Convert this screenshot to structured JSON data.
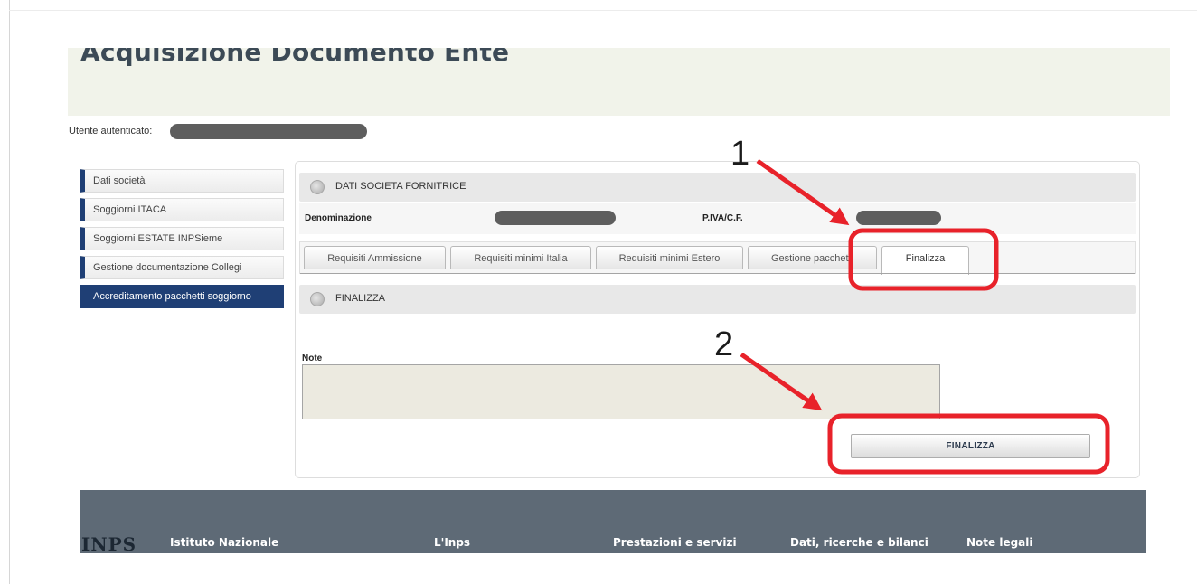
{
  "page_title": "Acquisizione Documento Ente",
  "user_label": "Utente autenticato:",
  "sidebar": {
    "items": [
      {
        "label": "Dati società",
        "active": false
      },
      {
        "label": "Soggiorni ITACA",
        "active": false
      },
      {
        "label": "Soggiorni ESTATE INPSieme",
        "active": false
      },
      {
        "label": "Gestione documentazione Collegi",
        "active": false
      },
      {
        "label": "Accreditamento pacchetti soggiorno",
        "active": true
      }
    ]
  },
  "section_company": {
    "title": "DATI SOCIETA FORNITRICE"
  },
  "info": {
    "denominazione_label": "Denominazione",
    "piva_label": "P.IVA/C.F."
  },
  "tabs": [
    {
      "label": "Requisiti Ammissione"
    },
    {
      "label": "Requisiti minimi Italia"
    },
    {
      "label": "Requisiti minimi Estero"
    },
    {
      "label": "Gestione pacchetti"
    },
    {
      "label": "Finalizza",
      "active": true
    }
  ],
  "section_finalizza": {
    "title": "FINALIZZA"
  },
  "note": {
    "label": "Note",
    "value": ""
  },
  "finalize_button": "FINALIZZA",
  "annotations": {
    "step1": "1",
    "step2": "2",
    "color": "#e8222a"
  },
  "footer": {
    "logo": "INPS",
    "links": [
      "Istituto Nazionale",
      "L'Inps",
      "Prestazioni e servizi",
      "Dati, ricerche e bilanci",
      "Note legali"
    ]
  },
  "colors": {
    "sidebar_accent": "#1f3f75",
    "footer_bg": "#5e6a76",
    "title_band": "#f1f3ea"
  }
}
